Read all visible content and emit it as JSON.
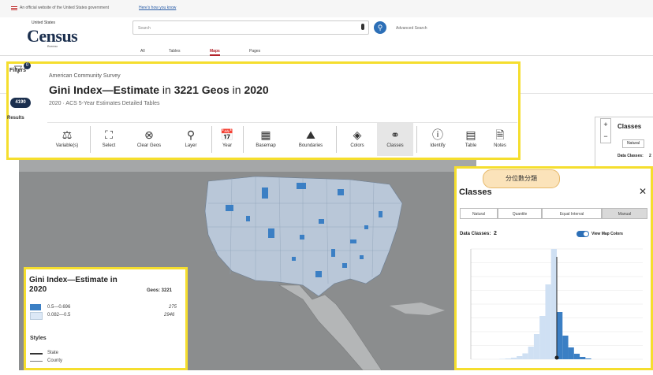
{
  "top_banner": {
    "official": "An official website of the United States government",
    "how_know": "Here's how you know"
  },
  "logo": {
    "small": "United States",
    "big": "Census",
    "sub": "Bureau"
  },
  "search": {
    "placeholder": "Search",
    "advanced": "Advanced Search"
  },
  "nav_tabs": [
    "All",
    "Tables",
    "Maps",
    "Pages"
  ],
  "active_tab": "Maps",
  "sidebar": {
    "filters_label": "Filters",
    "filter_count": "0",
    "results_count": "4190",
    "results_label": "Results"
  },
  "dataset": {
    "survey": "American Community Survey",
    "title_part1": "Gini Index—Estimate",
    "title_part2": " in ",
    "title_part3": "3221 Geos",
    "title_part4": " in ",
    "title_part5": "2020",
    "subtitle": "2020 · ACS 5-Year Estimates Detailed Tables"
  },
  "toolbar": {
    "tools": [
      {
        "label": "Variable(s)",
        "icon": "scale-icon"
      },
      {
        "label": "Select",
        "icon": "select-icon"
      },
      {
        "label": "Clear Geos",
        "icon": "clear-icon"
      },
      {
        "label": "Layer",
        "icon": "pin-icon"
      },
      {
        "label": "Year",
        "icon": "calendar-icon"
      },
      {
        "label": "Basemap",
        "icon": "grid-icon"
      },
      {
        "label": "Boundaries",
        "icon": "boundary-icon"
      },
      {
        "label": "Colors",
        "icon": "paint-icon"
      },
      {
        "label": "Classes",
        "icon": "classes-icon"
      },
      {
        "label": "Identify",
        "icon": "info-icon"
      },
      {
        "label": "Table",
        "icon": "table-icon"
      },
      {
        "label": "Notes",
        "icon": "notes-icon"
      }
    ],
    "selected": "Classes"
  },
  "right_panel": {
    "title": "Classes",
    "tab": "Natural",
    "data_classes_label": "Data Classes:",
    "data_classes": "2"
  },
  "zoom": {
    "in": "+",
    "out": "−"
  },
  "classes_panel": {
    "badge": "分位數分類",
    "title": "Classes",
    "close": "✕",
    "methods": [
      "Natural",
      "Quantile",
      "Equal Interval",
      "Manual"
    ],
    "selected_method": "Manual",
    "data_classes_label": "Data Classes:",
    "data_classes": "2",
    "view_map_colors": "View Map Colors",
    "toggle_on": true
  },
  "legend": {
    "title": "Gini Index—Estimate in 2020",
    "geos_label": "Geos: 3221",
    "items": [
      {
        "range": "0.5—0.696",
        "count": "275",
        "color": "#3b7fc4"
      },
      {
        "range": "0.082—0.5",
        "count": "2946",
        "color": "#dce8f6"
      }
    ],
    "styles_label": "Styles",
    "styles": [
      "State",
      "County"
    ]
  },
  "colors": {
    "highlight": "#f5de2e",
    "accent": "#2c6fb7",
    "dark_blue": "#3b7fc4",
    "light_blue": "#cfe0f3"
  },
  "chart_data": {
    "type": "bar",
    "title": "",
    "xlabel": "",
    "ylabel": "",
    "threshold": 0.5,
    "bins_low": [
      0.3,
      0.32,
      0.34,
      0.36,
      0.38,
      0.4,
      0.42,
      0.44,
      0.46,
      0.48,
      0.5,
      0.52,
      0.54,
      0.56,
      0.58,
      0.6
    ],
    "counts": [
      1,
      2,
      4,
      8,
      15,
      32,
      64,
      110,
      190,
      280,
      120,
      60,
      30,
      14,
      6,
      2
    ]
  }
}
